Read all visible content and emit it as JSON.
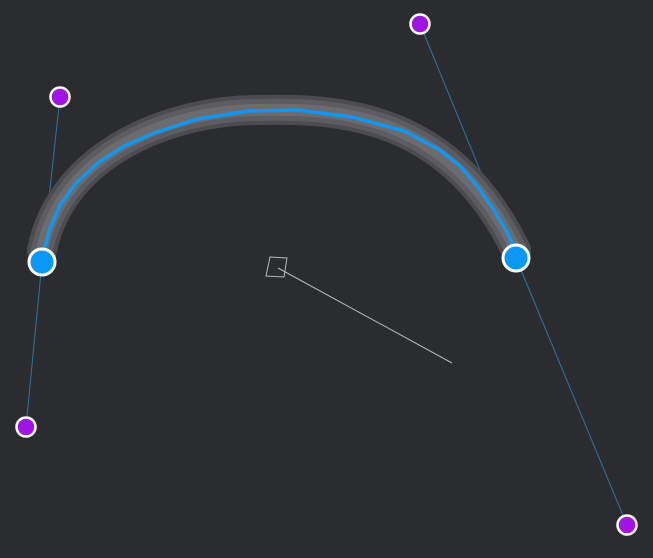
{
  "scene": {
    "background_color": "#2b2c30",
    "curve_color": "#0f97f2",
    "tube_color": "#5c5c61",
    "anchor_color": "#0a98f5",
    "control_color": "#a214e6",
    "handle_line_color": "#2a6f98",
    "anchor_points": [
      {
        "name": "anchor-point-start",
        "icon": "circle-node"
      },
      {
        "name": "anchor-point-end",
        "icon": "circle-node"
      }
    ],
    "control_points": [
      {
        "name": "control-handle-start-out",
        "icon": "circle-handle"
      },
      {
        "name": "control-handle-start-in",
        "icon": "circle-handle"
      },
      {
        "name": "control-handle-end-in",
        "icon": "circle-handle"
      },
      {
        "name": "control-handle-end-out",
        "icon": "circle-handle"
      }
    ],
    "gizmo": {
      "icon": "transform-gizmo-icon"
    }
  }
}
